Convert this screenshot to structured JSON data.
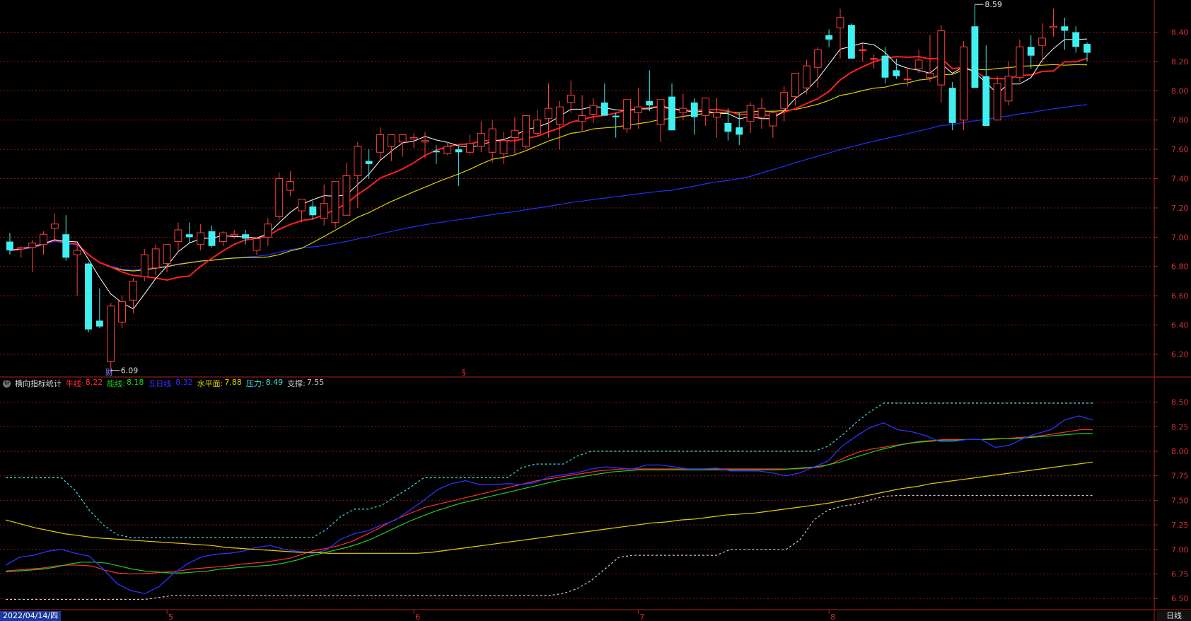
{
  "colors": {
    "background": "#000000",
    "grid": "#8b1a1a",
    "axis_text": "#d03030",
    "up_candle": "#ff4040",
    "down_candle": "#40f0f0",
    "ma5": "#ffffff",
    "ma10": "#ff2020",
    "ma20": "#e0d000",
    "ma60": "#2030ff",
    "bull_line": "#ff3030",
    "energy_line": "#20d020",
    "five_day_line": "#3030ff",
    "level_line": "#e0d000",
    "pressure_line": "#40e0e0",
    "support_line": "#e0e0e0"
  },
  "upper_annotations": {
    "high_label": "8.59",
    "low_label": "6.09",
    "event_marker_1": "财",
    "event_marker_2": "§"
  },
  "indicator_legend": {
    "icon": "gear-icon",
    "name": "横向指标统计",
    "items": [
      {
        "label": "牛线:",
        "value": "8.22",
        "color": "#ff3030"
      },
      {
        "label": "能线:",
        "value": "8.18",
        "color": "#20d020"
      },
      {
        "label": "五日线:",
        "value": "8.32",
        "color": "#3030ff"
      },
      {
        "label": "水平面:",
        "value": "7.88",
        "color": "#e0d000"
      },
      {
        "label": "压力:",
        "value": "8.49",
        "color": "#40e0e0"
      },
      {
        "label": "支撑:",
        "value": "7.55",
        "color": "#c8c8c8"
      }
    ]
  },
  "footer": {
    "date": "2022/04/14/四",
    "period": "日线"
  },
  "chart_data": [
    {
      "type": "candlestick",
      "yticks": [
        "8.40",
        "8.20",
        "8.00",
        "7.80",
        "7.60",
        "7.40",
        "7.20",
        "7.00",
        "6.80",
        "6.60",
        "6.40",
        "6.20"
      ],
      "ylim": [
        6.05,
        8.62
      ],
      "month_labels": [
        "5",
        "6",
        "7",
        "8"
      ],
      "month_index": [
        14,
        36,
        56,
        73
      ],
      "ohlc": [
        [
          6.97,
          7.03,
          6.88,
          6.91
        ],
        [
          6.92,
          6.94,
          6.86,
          6.93
        ],
        [
          6.93,
          6.98,
          6.76,
          6.96
        ],
        [
          6.95,
          7.04,
          6.88,
          7.02
        ],
        [
          7.06,
          7.16,
          6.98,
          7.09
        ],
        [
          7.02,
          7.15,
          6.84,
          6.86
        ],
        [
          6.88,
          6.95,
          6.6,
          6.91
        ],
        [
          6.82,
          6.83,
          6.35,
          6.37
        ],
        [
          6.43,
          6.65,
          6.38,
          6.39
        ],
        [
          6.15,
          6.55,
          6.09,
          6.53
        ],
        [
          6.42,
          6.6,
          6.38,
          6.56
        ],
        [
          6.57,
          6.72,
          6.48,
          6.7
        ],
        [
          6.73,
          6.92,
          6.7,
          6.88
        ],
        [
          6.79,
          6.95,
          6.74,
          6.92
        ],
        [
          6.82,
          6.95,
          6.76,
          6.95
        ],
        [
          6.97,
          7.1,
          6.9,
          7.05
        ],
        [
          7.02,
          7.1,
          6.96,
          7.0
        ],
        [
          6.95,
          7.09,
          6.91,
          7.03
        ],
        [
          7.04,
          7.08,
          6.93,
          6.94
        ],
        [
          6.97,
          7.04,
          6.94,
          7.03
        ],
        [
          7.01,
          7.05,
          6.99,
          7.02
        ],
        [
          7.02,
          7.05,
          6.95,
          6.99
        ],
        [
          6.91,
          7.0,
          6.88,
          6.99
        ],
        [
          7.0,
          7.13,
          6.94,
          7.09
        ],
        [
          7.14,
          7.44,
          7.12,
          7.4
        ],
        [
          7.32,
          7.45,
          7.28,
          7.38
        ],
        [
          7.18,
          7.25,
          7.1,
          7.26
        ],
        [
          7.21,
          7.25,
          7.12,
          7.15
        ],
        [
          7.13,
          7.36,
          7.08,
          7.23
        ],
        [
          7.1,
          7.33,
          7.06,
          7.38
        ],
        [
          7.15,
          7.51,
          7.18,
          7.42
        ],
        [
          7.42,
          7.65,
          7.2,
          7.62
        ],
        [
          7.52,
          7.6,
          7.4,
          7.5
        ],
        [
          7.58,
          7.75,
          7.52,
          7.7
        ],
        [
          7.62,
          7.68,
          7.52,
          7.7
        ],
        [
          7.65,
          7.7,
          7.55,
          7.7
        ],
        [
          7.67,
          7.71,
          7.61,
          7.68
        ],
        [
          7.65,
          7.72,
          7.54,
          7.66
        ],
        [
          7.59,
          7.63,
          7.5,
          7.58
        ],
        [
          7.57,
          7.65,
          7.56,
          7.62
        ],
        [
          7.6,
          7.62,
          7.35,
          7.58
        ],
        [
          7.58,
          7.7,
          7.56,
          7.64
        ],
        [
          7.62,
          7.79,
          7.58,
          7.71
        ],
        [
          7.58,
          7.8,
          7.51,
          7.74
        ],
        [
          7.57,
          7.72,
          7.5,
          7.66
        ],
        [
          7.68,
          7.82,
          7.57,
          7.73
        ],
        [
          7.62,
          7.8,
          7.6,
          7.83
        ],
        [
          7.71,
          7.87,
          7.69,
          7.8
        ],
        [
          7.81,
          8.05,
          7.68,
          7.88
        ],
        [
          7.77,
          7.93,
          7.6,
          7.89
        ],
        [
          7.92,
          8.07,
          7.85,
          7.97
        ],
        [
          7.79,
          7.97,
          7.72,
          7.83
        ],
        [
          7.84,
          7.95,
          7.78,
          7.9
        ],
        [
          7.92,
          8.05,
          7.85,
          7.83
        ],
        [
          7.83,
          7.85,
          7.68,
          7.82
        ],
        [
          7.74,
          7.88,
          7.71,
          7.94
        ],
        [
          7.85,
          8.02,
          7.74,
          7.89
        ],
        [
          7.93,
          8.14,
          7.86,
          7.9
        ],
        [
          7.77,
          7.9,
          7.65,
          7.94
        ],
        [
          7.96,
          8.05,
          7.74,
          7.73
        ],
        [
          7.85,
          7.98,
          7.8,
          7.88
        ],
        [
          7.92,
          7.95,
          7.7,
          7.82
        ],
        [
          7.83,
          7.92,
          7.76,
          7.95
        ],
        [
          7.82,
          7.95,
          7.68,
          7.85
        ],
        [
          7.78,
          7.88,
          7.66,
          7.72
        ],
        [
          7.75,
          7.85,
          7.63,
          7.7
        ],
        [
          7.79,
          7.92,
          7.71,
          7.9
        ],
        [
          7.82,
          7.95,
          7.74,
          7.88
        ],
        [
          7.76,
          7.87,
          7.68,
          7.85
        ],
        [
          7.88,
          8.03,
          7.79,
          7.99
        ],
        [
          7.96,
          8.11,
          7.9,
          8.12
        ],
        [
          8.02,
          8.21,
          7.98,
          8.17
        ],
        [
          8.16,
          8.3,
          8.02,
          8.28
        ],
        [
          8.38,
          8.42,
          8.3,
          8.35
        ],
        [
          8.43,
          8.56,
          8.22,
          8.5
        ],
        [
          8.45,
          8.46,
          8.22,
          8.22
        ],
        [
          8.28,
          8.32,
          8.2,
          8.28
        ],
        [
          8.22,
          8.25,
          8.15,
          8.22
        ],
        [
          8.24,
          8.3,
          8.05,
          8.09
        ],
        [
          8.14,
          8.22,
          8.08,
          8.1
        ],
        [
          8.08,
          8.16,
          8.03,
          8.08
        ],
        [
          8.15,
          8.28,
          8.12,
          8.21
        ],
        [
          8.09,
          8.38,
          8.06,
          8.12
        ],
        [
          8.04,
          8.45,
          7.92,
          8.41
        ],
        [
          8.02,
          8.06,
          7.73,
          7.78
        ],
        [
          7.8,
          8.34,
          7.73,
          8.3
        ],
        [
          8.44,
          8.59,
          8.02,
          8.02
        ],
        [
          8.1,
          8.31,
          7.76,
          7.76
        ],
        [
          7.8,
          8.1,
          7.81,
          8.05
        ],
        [
          7.93,
          8.2,
          7.9,
          8.1
        ],
        [
          8.09,
          8.35,
          8.06,
          8.3
        ],
        [
          8.3,
          8.38,
          8.15,
          8.24
        ],
        [
          8.31,
          8.46,
          8.19,
          8.36
        ],
        [
          8.43,
          8.56,
          8.37,
          8.44
        ],
        [
          8.44,
          8.5,
          8.28,
          8.41
        ],
        [
          8.4,
          8.44,
          8.26,
          8.3
        ],
        [
          8.32,
          8.33,
          8.2,
          8.26
        ]
      ]
    },
    {
      "type": "line",
      "title": "横向指标统计",
      "yticks": [
        "8.50",
        "8.25",
        "8.00",
        "7.75",
        "7.50",
        "7.25",
        "7.00",
        "6.75",
        "6.50"
      ],
      "ylim": [
        6.4,
        8.62
      ],
      "series": [
        {
          "name": "牛线",
          "color": "#ff3030",
          "values": [
            6.78,
            6.79,
            6.8,
            6.81,
            6.83,
            6.84,
            6.84,
            6.83,
            6.79,
            6.76,
            6.75,
            6.75,
            6.76,
            6.77,
            6.78,
            6.8,
            6.81,
            6.82,
            6.83,
            6.85,
            6.86,
            6.87,
            6.89,
            6.91,
            6.95,
            6.99,
            7.01,
            7.04,
            7.08,
            7.14,
            7.2,
            7.27,
            7.33,
            7.38,
            7.43,
            7.46,
            7.49,
            7.52,
            7.55,
            7.58,
            7.61,
            7.64,
            7.67,
            7.7,
            7.72,
            7.74,
            7.76,
            7.78,
            7.8,
            7.81,
            7.82,
            7.82,
            7.82,
            7.82,
            7.82,
            7.82,
            7.82,
            7.82,
            7.82,
            7.82,
            7.82,
            7.82,
            7.82,
            7.82,
            7.82,
            7.83,
            7.84,
            7.88,
            7.94,
            7.99,
            8.02,
            8.04,
            8.06,
            8.08,
            8.1,
            8.11,
            8.12,
            8.12,
            8.12,
            8.12,
            8.13,
            8.13,
            8.14,
            8.15,
            8.16,
            8.18,
            8.2,
            8.22,
            8.22
          ]
        },
        {
          "name": "能线",
          "color": "#20d020",
          "values": [
            6.77,
            6.78,
            6.79,
            6.8,
            6.82,
            6.85,
            6.87,
            6.87,
            6.86,
            6.83,
            6.8,
            6.78,
            6.77,
            6.76,
            6.76,
            6.77,
            6.78,
            6.8,
            6.81,
            6.82,
            6.83,
            6.84,
            6.86,
            6.89,
            6.93,
            6.96,
            6.99,
            7.02,
            7.06,
            7.11,
            7.17,
            7.23,
            7.29,
            7.34,
            7.39,
            7.43,
            7.47,
            7.5,
            7.53,
            7.56,
            7.59,
            7.62,
            7.65,
            7.68,
            7.71,
            7.73,
            7.75,
            7.77,
            7.79,
            7.8,
            7.81,
            7.81,
            7.81,
            7.81,
            7.81,
            7.81,
            7.81,
            7.81,
            7.81,
            7.81,
            7.81,
            7.81,
            7.82,
            7.83,
            7.84,
            7.86,
            7.89,
            7.93,
            7.97,
            8.01,
            8.04,
            8.07,
            8.09,
            8.1,
            8.11,
            8.11,
            8.12,
            8.12,
            8.12,
            8.13,
            8.13,
            8.14,
            8.15,
            8.16,
            8.17,
            8.18,
            8.18
          ]
        },
        {
          "name": "五日线",
          "color": "#3030ff",
          "values": [
            6.84,
            6.92,
            6.94,
            6.98,
            7.0,
            6.96,
            6.93,
            6.8,
            6.65,
            6.58,
            6.55,
            6.62,
            6.75,
            6.85,
            6.92,
            6.95,
            6.96,
            6.98,
            7.02,
            7.04,
            7.0,
            6.98,
            6.96,
            6.99,
            7.1,
            7.16,
            7.19,
            7.25,
            7.3,
            7.4,
            7.5,
            7.61,
            7.67,
            7.7,
            7.66,
            7.66,
            7.67,
            7.66,
            7.68,
            7.74,
            7.76,
            7.78,
            7.82,
            7.84,
            7.83,
            7.82,
            7.86,
            7.86,
            7.84,
            7.82,
            7.82,
            7.83,
            7.8,
            7.8,
            7.8,
            7.78,
            7.75,
            7.78,
            7.84,
            7.9,
            8.05,
            8.15,
            8.24,
            8.29,
            8.22,
            8.2,
            8.16,
            8.1,
            8.1,
            8.12,
            8.12,
            8.04,
            8.06,
            8.13,
            8.18,
            8.22,
            8.32,
            8.36,
            8.32
          ]
        },
        {
          "name": "水平面",
          "color": "#e0d000",
          "values": [
            7.3,
            7.26,
            7.22,
            7.19,
            7.16,
            7.14,
            7.12,
            7.11,
            7.1,
            7.09,
            7.08,
            7.07,
            7.06,
            7.05,
            7.04,
            7.02,
            7.01,
            7.0,
            6.99,
            6.98,
            6.97,
            6.97,
            6.96,
            6.96,
            6.96,
            6.96,
            6.96,
            6.96,
            6.96,
            6.97,
            6.99,
            7.01,
            7.03,
            7.05,
            7.07,
            7.09,
            7.11,
            7.13,
            7.15,
            7.17,
            7.19,
            7.21,
            7.23,
            7.25,
            7.27,
            7.28,
            7.3,
            7.31,
            7.33,
            7.35,
            7.36,
            7.37,
            7.39,
            7.41,
            7.43,
            7.45,
            7.47,
            7.5,
            7.53,
            7.56,
            7.59,
            7.62,
            7.64,
            7.67,
            7.69,
            7.71,
            7.73,
            7.75,
            7.77,
            7.79,
            7.81,
            7.83,
            7.85,
            7.87,
            7.89
          ]
        },
        {
          "name": "压力",
          "color": "#40e0e0",
          "values": [
            7.73,
            7.73,
            7.73,
            7.73,
            7.73,
            7.6,
            7.4,
            7.25,
            7.15,
            7.12,
            7.12,
            7.12,
            7.12,
            7.12,
            7.12,
            7.12,
            7.12,
            7.12,
            7.12,
            7.12,
            7.12,
            7.12,
            7.12,
            7.2,
            7.33,
            7.41,
            7.41,
            7.45,
            7.54,
            7.63,
            7.73,
            7.73,
            7.73,
            7.73,
            7.73,
            7.73,
            7.73,
            7.83,
            7.87,
            7.87,
            7.87,
            7.95,
            8.0,
            8.0,
            8.0,
            8.0,
            8.0,
            8.0,
            8.0,
            8.0,
            8.0,
            8.0,
            8.0,
            8.0,
            8.0,
            8.0,
            8.0,
            8.0,
            8.0,
            8.05,
            8.16,
            8.29,
            8.4,
            8.49,
            8.49,
            8.49,
            8.49,
            8.49,
            8.49,
            8.49,
            8.49,
            8.49,
            8.49,
            8.49,
            8.49,
            8.49,
            8.49,
            8.49,
            8.49
          ]
        },
        {
          "name": "支撑",
          "color": "#c8c8c8",
          "values": [
            6.49,
            6.49,
            6.49,
            6.49,
            6.49,
            6.49,
            6.49,
            6.49,
            6.49,
            6.49,
            6.49,
            6.51,
            6.53,
            6.53,
            6.53,
            6.53,
            6.53,
            6.53,
            6.53,
            6.53,
            6.53,
            6.53,
            6.53,
            6.53,
            6.53,
            6.53,
            6.53,
            6.53,
            6.53,
            6.53,
            6.53,
            6.53,
            6.53,
            6.53,
            6.53,
            6.53,
            6.53,
            6.53,
            6.53,
            6.53,
            6.55,
            6.6,
            6.68,
            6.8,
            6.92,
            6.94,
            6.94,
            6.94,
            6.94,
            6.94,
            6.94,
            6.94,
            7.0,
            7.0,
            7.0,
            7.0,
            7.0,
            7.1,
            7.3,
            7.4,
            7.44,
            7.46,
            7.5,
            7.54,
            7.55,
            7.55,
            7.55,
            7.55,
            7.55,
            7.55,
            7.55,
            7.55,
            7.55,
            7.55,
            7.55,
            7.55,
            7.55,
            7.55,
            7.55
          ]
        }
      ]
    }
  ]
}
